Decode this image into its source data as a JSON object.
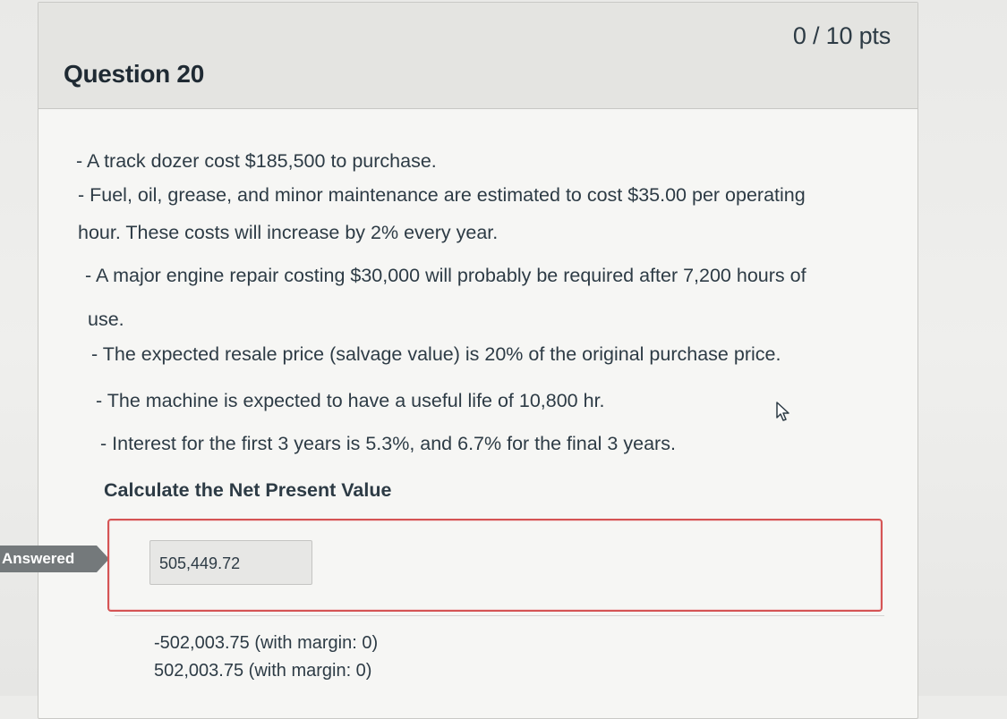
{
  "question": {
    "title": "Question 20",
    "points": "0 / 10 pts",
    "lines": [
      "- A track dozer cost $185,500 to purchase.",
      "- Fuel, oil, grease, and minor maintenance are estimated to cost $35.00 per operating",
      "hour. These costs will increase by 2% every year.",
      "- A major engine repair costing $30,000 will probably be required after 7,200 hours of",
      "use.",
      "- The expected resale price (salvage value) is 20% of the original purchase price.",
      "- The machine is expected to have a useful life of 10,800 hr.",
      "- Interest for the first 3 years is 5.3%, and 6.7% for the final 3 years."
    ],
    "prompt": "Calculate the Net Present Value"
  },
  "answer": {
    "status_label": "Answered",
    "submitted_value": "505,449.72",
    "correct_answers": [
      "-502,003.75 (with margin: 0)",
      "502,003.75 (with margin: 0)"
    ]
  },
  "colors": {
    "incorrect_border": "#d55454",
    "badge": "#74797b",
    "header": "#e4e4e1"
  },
  "icons": [
    "pointer-cursor-icon"
  ]
}
